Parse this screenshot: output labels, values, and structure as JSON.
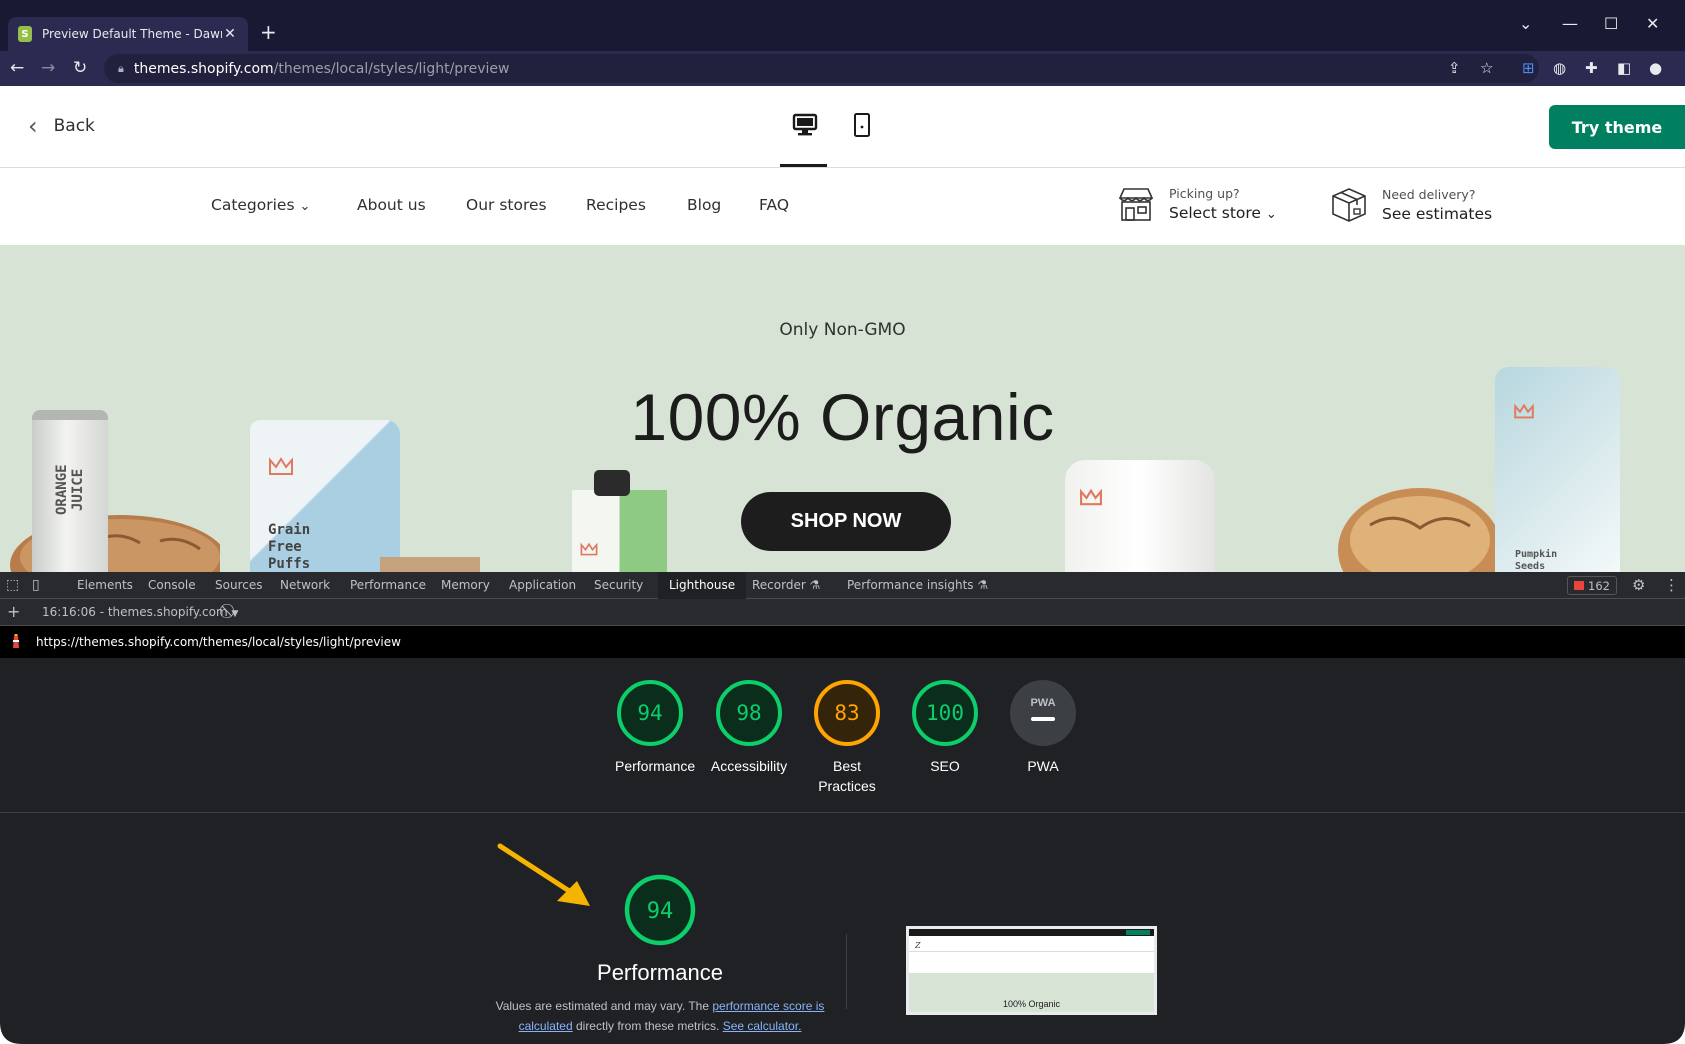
{
  "browser": {
    "tab_title": "Preview Default Theme - Dawn Ed",
    "url_host": "themes.shopify.com",
    "url_path": "/themes/local/styles/light/preview"
  },
  "preview_bar": {
    "back_label": "Back",
    "try_theme_label": "Try theme"
  },
  "store_nav": {
    "items": [
      "Categories",
      "About us",
      "Our stores",
      "Recipes",
      "Blog",
      "FAQ"
    ],
    "pickup_small": "Picking up?",
    "pickup_big": "Select store",
    "delivery_small": "Need delivery?",
    "delivery_big": "See estimates"
  },
  "hero": {
    "subtitle": "Only Non-GMO",
    "title": "100% Organic",
    "cta": "SHOP NOW",
    "product_orange_juice": "ORANGE JUICE",
    "product_grain_puffs": "Grain Free Puffs",
    "product_pumpkin": "Pumpkin Seeds"
  },
  "devtools": {
    "tabs": [
      "Elements",
      "Console",
      "Sources",
      "Network",
      "Performance",
      "Memory",
      "Application",
      "Security",
      "Lighthouse",
      "Recorder",
      "Performance insights"
    ],
    "active_tab": "Lighthouse",
    "issues_count": "162",
    "report_selector": "16:16:06 - themes.shopify.com",
    "report_url": "https://themes.shopify.com/themes/local/styles/light/preview"
  },
  "lighthouse": {
    "scores": [
      {
        "label": "Performance",
        "score": 94,
        "color": "#0cce6b"
      },
      {
        "label": "Accessibility",
        "score": 98,
        "color": "#0cce6b"
      },
      {
        "label": "Best Practices",
        "score": 83,
        "color": "#ffa400"
      },
      {
        "label": "SEO",
        "score": 100,
        "color": "#0cce6b"
      },
      {
        "label": "PWA",
        "score": null,
        "color": "#9aa0a6"
      }
    ],
    "pwa_badge": "PWA",
    "main_score": 94,
    "main_label": "Performance",
    "note_prefix": "Values are estimated and may vary. The ",
    "note_link1": "performance score is calculated",
    "note_middle": " directly from these metrics. ",
    "note_link2": "See calculator.",
    "thumb_title": "100% Organic"
  },
  "colors": {
    "pass": "#0cce6b",
    "average": "#ffa400",
    "shopify_green": "#008060",
    "arrow": "#f5b400"
  }
}
